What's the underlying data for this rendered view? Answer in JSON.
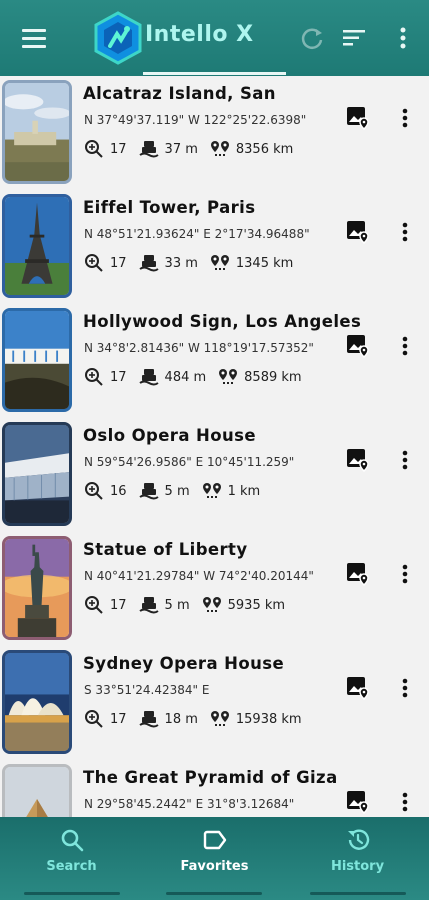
{
  "app": {
    "title": "Intello X"
  },
  "tabs": [
    {
      "label": "Search"
    },
    {
      "label": "Favorites"
    },
    {
      "label": "History"
    }
  ],
  "items": [
    {
      "name": "Alcatraz Island, San",
      "coords": "N 37°49'37.119\" W 122°25'22.6398\"",
      "zoom": "17",
      "altitude": "37 m",
      "distance": "8356 km"
    },
    {
      "name": "Eiffel Tower, Paris",
      "coords": "N 48°51'21.93624\" E 2°17'34.96488\"",
      "zoom": "17",
      "altitude": "33 m",
      "distance": "1345 km"
    },
    {
      "name": "Hollywood Sign, Los Angeles",
      "coords": "N 34°8'2.81436\" W 118°19'17.57352\"",
      "zoom": "17",
      "altitude": "484 m",
      "distance": "8589 km"
    },
    {
      "name": "Oslo Opera House",
      "coords": "N 59°54'26.9586\" E 10°45'11.259\"",
      "zoom": "16",
      "altitude": "5 m",
      "distance": "1 km"
    },
    {
      "name": "Statue of Liberty",
      "coords": "N 40°41'21.29784\" W 74°2'40.20144\"",
      "zoom": "17",
      "altitude": "5 m",
      "distance": "5935 km"
    },
    {
      "name": "Sydney Opera House",
      "coords": "S 33°51'24.42384\" E",
      "zoom": "17",
      "altitude": "18 m",
      "distance": "15938 km"
    },
    {
      "name": "The Great Pyramid of Giza",
      "coords": "N 29°58'45.2442\" E 31°8'3.12684\"",
      "zoom": "",
      "altitude": "",
      "distance": ""
    }
  ],
  "colors": {
    "appbar": "#1e7a75",
    "accent": "#7fe6dc",
    "background": "#f2f2f2"
  }
}
